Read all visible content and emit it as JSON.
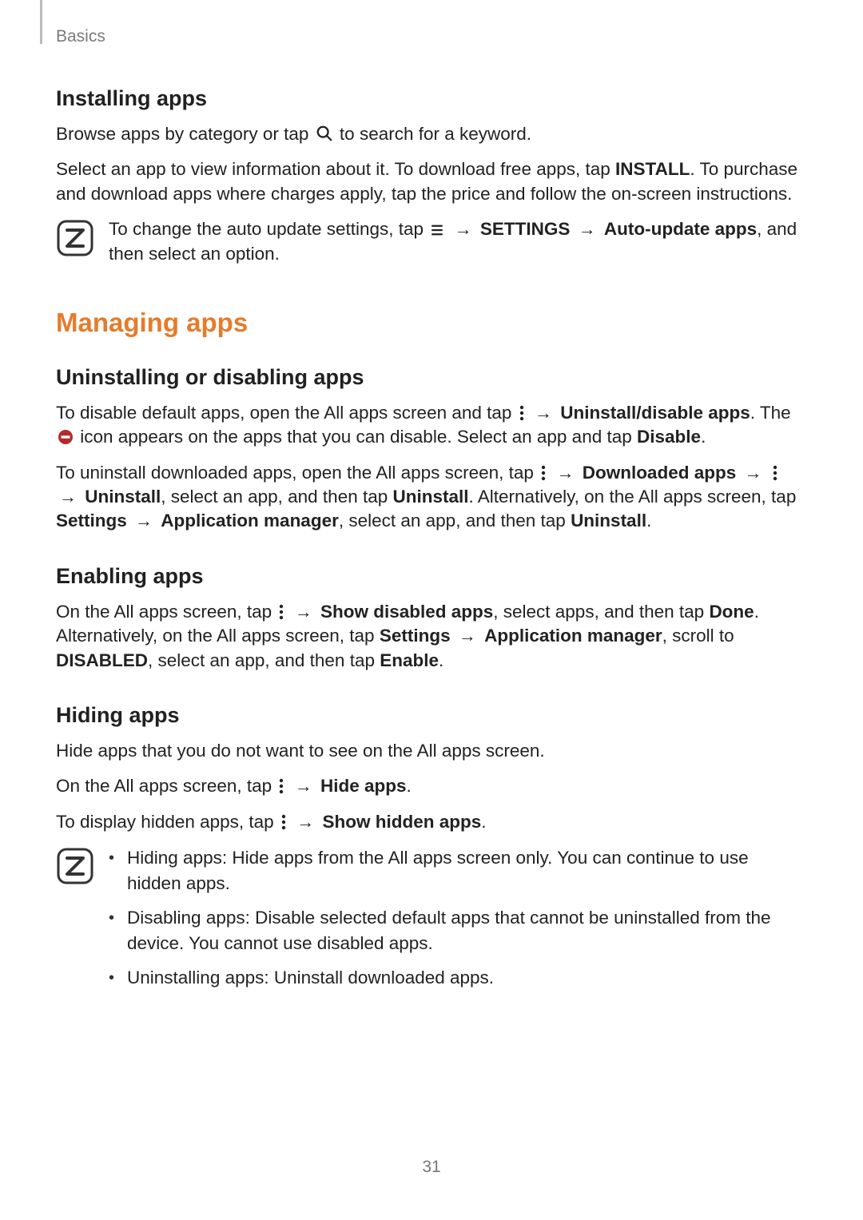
{
  "breadcrumb": "Basics",
  "page_number": "31",
  "colors": {
    "accent": "#e67b2b"
  },
  "installing": {
    "heading": "Installing apps",
    "p1_a": "Browse apps by category or tap ",
    "p1_b": " to search for a keyword.",
    "p2_a": "Select an app to view information about it. To download free apps, tap ",
    "p2_install": "INSTALL",
    "p2_b": ". To purchase and download apps where charges apply, tap the price and follow the on-screen instructions.",
    "note_a": "To change the auto update settings, tap ",
    "note_arrow1": "→",
    "note_settings": "SETTINGS",
    "note_arrow2": "→",
    "note_auto": "Auto-update apps",
    "note_b": ", and then select an option."
  },
  "managing": {
    "heading": "Managing apps",
    "uninstall": {
      "heading": "Uninstalling or disabling apps",
      "p1_a": "To disable default apps, open the All apps screen and tap ",
      "p1_arrow": "→",
      "p1_uninstall": "Uninstall/disable apps",
      "p1_b": ". The ",
      "p1_c": " icon appears on the apps that you can disable. Select an app and tap ",
      "p1_disable": "Disable",
      "p1_d": ".",
      "p2_a": "To uninstall downloaded apps, open the All apps screen, tap ",
      "p2_arrow1": "→",
      "p2_downloaded": "Downloaded apps",
      "p2_arrow2": "→",
      "p2_arrow3": "→",
      "p2_uninstall1": "Uninstall",
      "p2_b": ", select an app, and then tap ",
      "p2_uninstall2": "Uninstall",
      "p2_c": ". Alternatively, on the All apps screen, tap ",
      "p2_settings": "Settings",
      "p2_arrow4": "→",
      "p2_appmgr": "Application manager",
      "p2_d": ", select an app, and then tap ",
      "p2_uninstall3": "Uninstall",
      "p2_e": "."
    },
    "enabling": {
      "heading": "Enabling apps",
      "p1_a": "On the All apps screen, tap ",
      "p1_arrow": "→",
      "p1_show": "Show disabled apps",
      "p1_b": ", select apps, and then tap ",
      "p1_done": "Done",
      "p1_c": ". Alternatively, on the All apps screen, tap ",
      "p1_settings": "Settings",
      "p1_arrow2": "→",
      "p1_appmgr": "Application manager",
      "p1_d": ", scroll to ",
      "p1_disabled": "DISABLED",
      "p1_e": ", select an app, and then tap ",
      "p1_enable": "Enable",
      "p1_f": "."
    },
    "hiding": {
      "heading": "Hiding apps",
      "p1": "Hide apps that you do not want to see on the All apps screen.",
      "p2_a": "On the All apps screen, tap ",
      "p2_arrow": "→",
      "p2_hide": "Hide apps",
      "p2_b": ".",
      "p3_a": "To display hidden apps, tap ",
      "p3_arrow": "→",
      "p3_show": "Show hidden apps",
      "p3_b": ".",
      "bullets": [
        "Hiding apps: Hide apps from the All apps screen only. You can continue to use hidden apps.",
        "Disabling apps: Disable selected default apps that cannot be uninstalled from the device. You cannot use disabled apps.",
        "Uninstalling apps: Uninstall downloaded apps."
      ]
    }
  }
}
